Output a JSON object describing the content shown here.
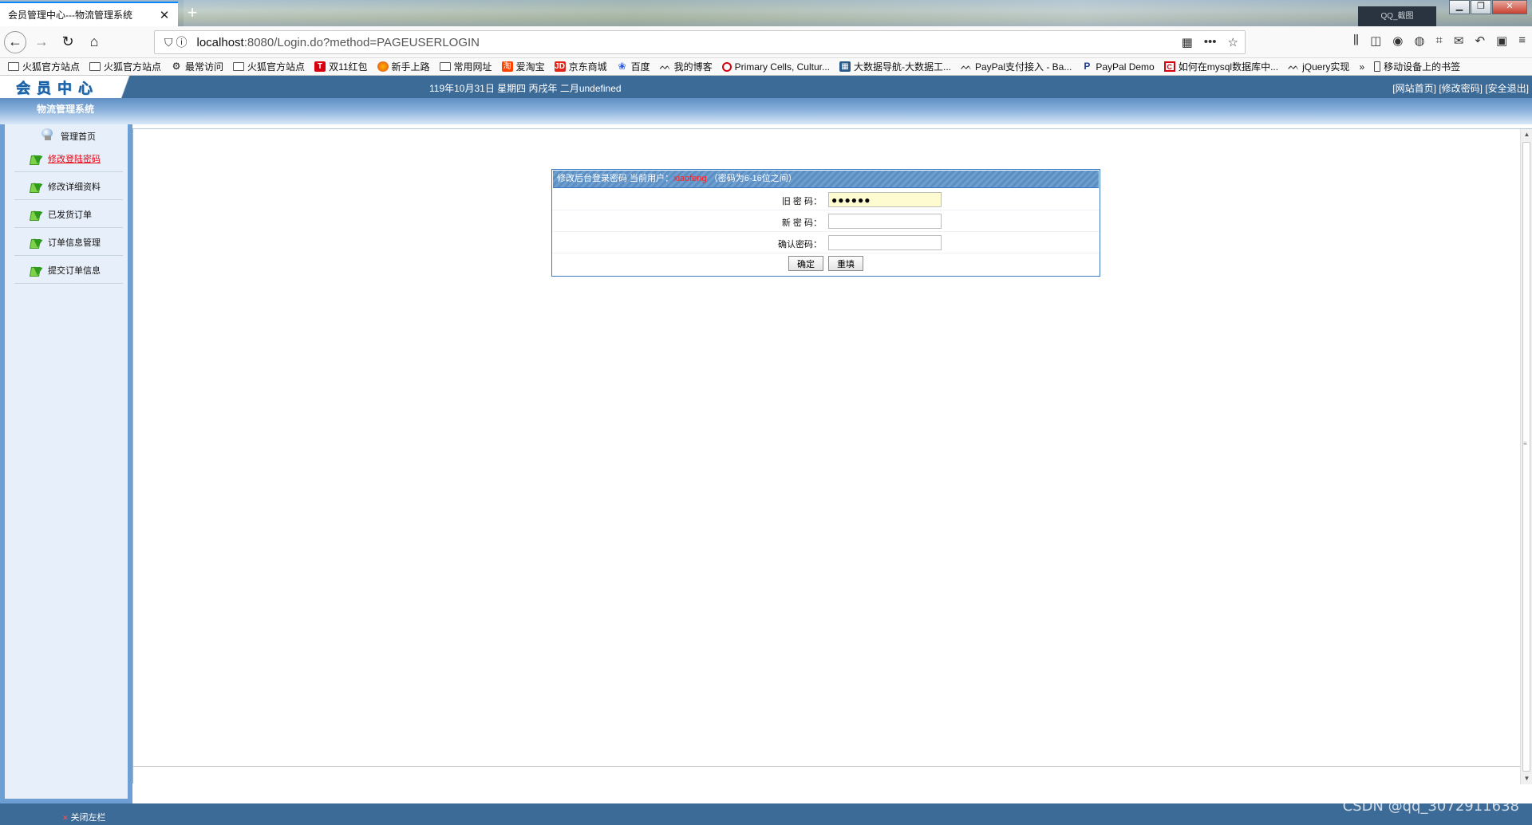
{
  "browser": {
    "tab_title": "会员管理中心---物流管理系统",
    "url_host": "localhost",
    "url_rest": ":8080/Login.do?method=PAGEUSERLOGIN",
    "dark_box_text": "QQ_截图"
  },
  "bookmarks": [
    {
      "label": "火狐官方站点",
      "icon": "folder-icon"
    },
    {
      "label": "火狐官方站点",
      "icon": "folder-icon"
    },
    {
      "label": "最常访问",
      "icon": "gear-icon"
    },
    {
      "label": "火狐官方站点",
      "icon": "folder-icon"
    },
    {
      "label": "双11红包",
      "icon": "tmall-icon"
    },
    {
      "label": "新手上路",
      "icon": "firefox-icon"
    },
    {
      "label": "常用网址",
      "icon": "folder-icon"
    },
    {
      "label": "爱淘宝",
      "icon": "taobao-icon"
    },
    {
      "label": "京东商城",
      "icon": "jd-icon"
    },
    {
      "label": "百度",
      "icon": "baidu-icon"
    },
    {
      "label": "我的博客",
      "icon": "csdn-icon"
    },
    {
      "label": "Primary Cells, Cultur...",
      "icon": "opera-icon"
    },
    {
      "label": "大数据导航-大数据工...",
      "icon": "dbnav-icon"
    },
    {
      "label": "PayPal支付接入 - Ba...",
      "icon": "csdn-icon"
    },
    {
      "label": "PayPal Demo",
      "icon": "paypal-icon"
    },
    {
      "label": "如何在mysql数据库中...",
      "icon": "c-icon"
    },
    {
      "label": "jQuery实现",
      "icon": "csdn-icon"
    },
    {
      "label": "移动设备上的书签",
      "icon": "mobile-icon"
    }
  ],
  "header": {
    "logo_text": "会员中心",
    "date_text": "119年10月31日 星期四 丙戌年 二月undefined",
    "link_home": "[网站首页]",
    "link_changepw": "[修改密码]",
    "link_logout": "[安全退出]",
    "system_title": "物流管理系统"
  },
  "sidebar": {
    "home_label": "管理首页",
    "items": [
      {
        "label": "修改登陆密码",
        "active": true
      },
      {
        "label": "修改详细资料",
        "active": false
      },
      {
        "label": "已发货订单",
        "active": false
      },
      {
        "label": "订单信息管理",
        "active": false
      },
      {
        "label": "提交订单信息",
        "active": false
      }
    ]
  },
  "form": {
    "header_prefix": "修改后台登录密码 当前用户：",
    "current_user": "xiaofeng",
    "header_suffix": "（密码为6-16位之间）",
    "old_label": "旧 密 码：",
    "old_value": "●●●●●●",
    "new_label": "新 密 码：",
    "new_value": "",
    "confirm_label": "确认密码：",
    "confirm_value": "",
    "ok_label": "确定",
    "reset_label": "重填"
  },
  "footer": {
    "close_label": "关闭左栏",
    "watermark": "CSDN @qq_3072911638"
  },
  "colors": {
    "header_blue": "#3d6b98",
    "active_red": "#e60012",
    "panel_border": "#3b78c7"
  }
}
